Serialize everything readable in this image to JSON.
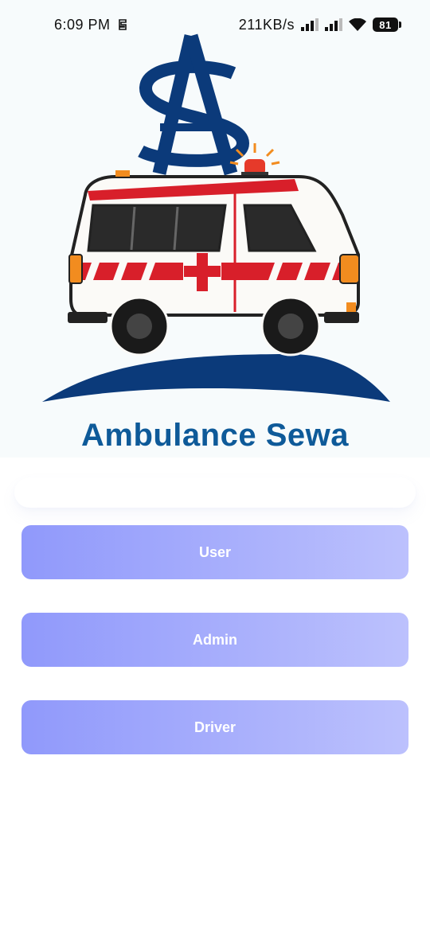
{
  "status_bar": {
    "time": "6:09 PM",
    "net_speed": "211KB/s",
    "battery": "81"
  },
  "app_title": "Ambulance Sewa",
  "buttons": {
    "user": "User",
    "admin": "Admin",
    "driver": "Driver"
  },
  "colors": {
    "title": "#0e5a99",
    "button_start": "#9099fb",
    "button_end": "#bcc1fd",
    "logo_navy": "#0b3a7a",
    "ambulance_red": "#d81f2a"
  }
}
